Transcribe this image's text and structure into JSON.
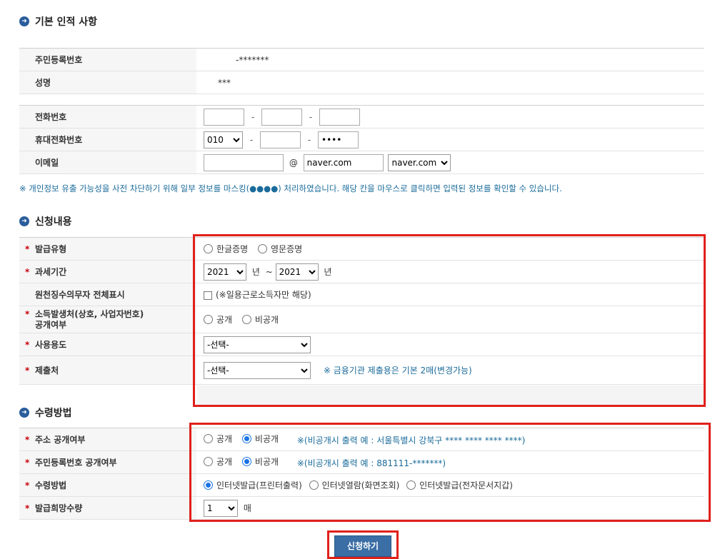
{
  "sections": {
    "basic": "기본 인적 사항",
    "apply": "신청내용",
    "receive": "수령방법"
  },
  "basic": {
    "ssn_label": "주민등록번호",
    "ssn_value": "-*******",
    "name_label": "성명",
    "name_value": "***",
    "phone_label": "전화번호",
    "mobile_label": "휴대전화번호",
    "mobile_prefix": "010",
    "mobile_last": "••••",
    "email_label": "이메일",
    "email_at": "@",
    "email_domain": "naver.com",
    "email_domain_select": "naver.com",
    "dash": "-"
  },
  "notice": "※ 개인정보 유출 가능성을 사전 차단하기 위해 일부 정보를 마스킹(●●●●) 처리하였습니다. 해당 칸을 마우스로 클릭하면 입력된 정보를 확인할 수 있습니다.",
  "apply": {
    "star": "*",
    "issue_type_label": "발급유형",
    "issue_type_opt1": "한글증명",
    "issue_type_opt2": "영문증명",
    "period_label": "과세기간",
    "period_from": "2021",
    "period_year1": "년",
    "period_tilde": "~",
    "period_to": "2021",
    "period_year2": "년",
    "withholding_label": "원천징수의무자 전체표시",
    "withholding_check": "(※일용근로소득자만 해당)",
    "income_label_1": "소득발생처(상호, 사업자번호)",
    "income_label_2": "공개여부",
    "income_opt1": "공개",
    "income_opt2": "비공개",
    "usage_label": "사용용도",
    "usage_select": "-선택-",
    "submit_to_label": "제출처",
    "submit_to_select": "-선택-",
    "submit_to_note": "※ 금융기관 제출용은 기본 2매(변경가능)"
  },
  "receive": {
    "addr_label": "주소 공개여부",
    "addr_opt1": "공개",
    "addr_opt2": "비공개",
    "addr_note": "※(비공개시 출력 예 : 서울특별시 강북구 **** **** **** ****)",
    "ssn_label": "주민등록번호 공개여부",
    "ssn_opt1": "공개",
    "ssn_opt2": "비공개",
    "ssn_note": "※(비공개시 출력 예 : 881111-*******)",
    "method_label": "수령방법",
    "method_opt1": "인터넷발급(프린터출력)",
    "method_opt2": "인터넷열람(화면조회)",
    "method_opt3": "인터넷발급(전자문서지갑)",
    "qty_label": "발급희망수량",
    "qty_value": "1",
    "qty_unit": "매"
  },
  "submit_label": "신청하기"
}
